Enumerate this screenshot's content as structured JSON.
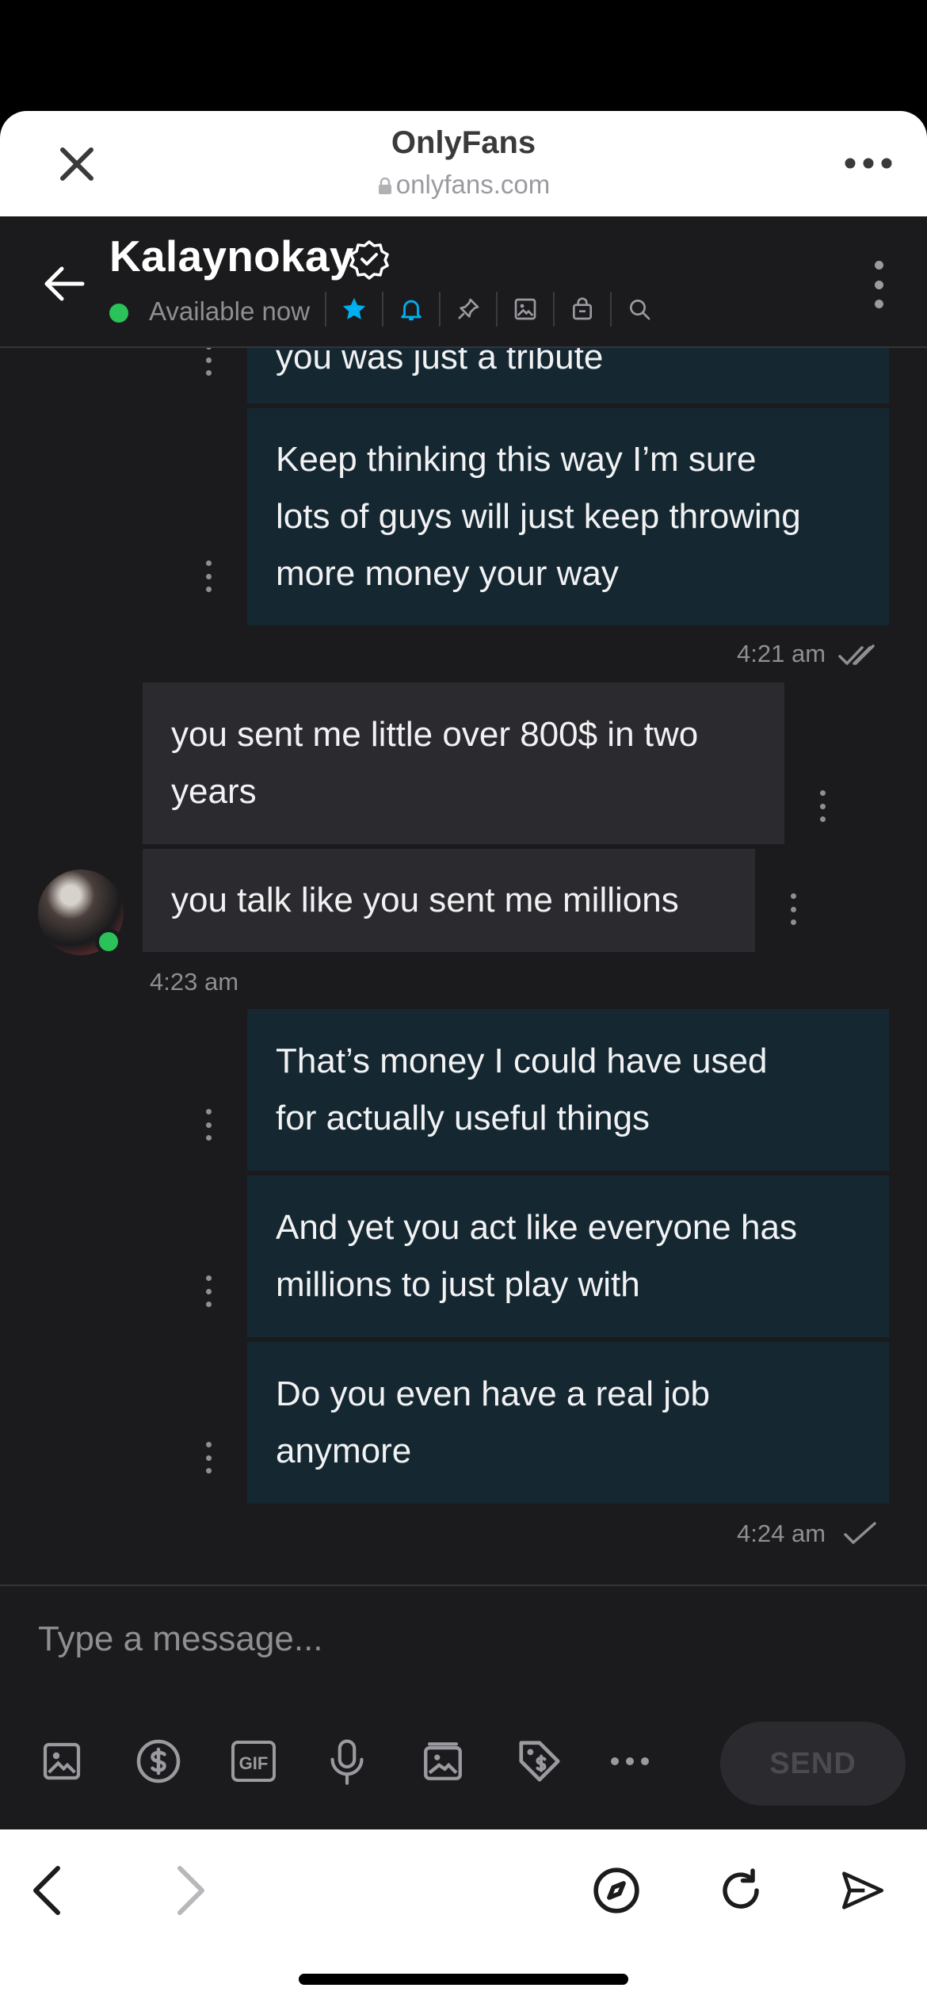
{
  "browser": {
    "site_title": "OnlyFans",
    "url": "onlyfans.com"
  },
  "chat_header": {
    "username": "Kalaynokay",
    "status": "Available now"
  },
  "messages": [
    {
      "id": "m0",
      "direction": "outgoing",
      "text": "you was just a tribute"
    },
    {
      "id": "m1",
      "direction": "outgoing",
      "text": "Keep thinking this way I’m sure\nlots of guys will just keep throwing\nmore money your way"
    },
    {
      "id": "m2",
      "direction": "incoming",
      "text": "you sent me little over 800$ in two\nyears"
    },
    {
      "id": "m3",
      "direction": "incoming",
      "text": "you talk like you sent me millions"
    },
    {
      "id": "m4",
      "direction": "outgoing",
      "text": "That’s money I could have used\nfor actually useful things"
    },
    {
      "id": "m5",
      "direction": "outgoing",
      "text": "And yet you act like everyone has\nmillions to just play with"
    },
    {
      "id": "m6",
      "direction": "outgoing",
      "text": "Do you even have a real job\nanymore"
    }
  ],
  "timestamps": {
    "t1": "4:21 am",
    "t2": "4:23 am",
    "t3": "4:24 am"
  },
  "composer": {
    "placeholder": "Type a message...",
    "send_label": "SEND",
    "gif_label": "GIF"
  },
  "colors": {
    "background": "#1b1b1d",
    "outgoing_bubble": "#152831",
    "incoming_bubble": "#2b2b2f",
    "accent": "#00aff0",
    "online": "#2bc259"
  }
}
